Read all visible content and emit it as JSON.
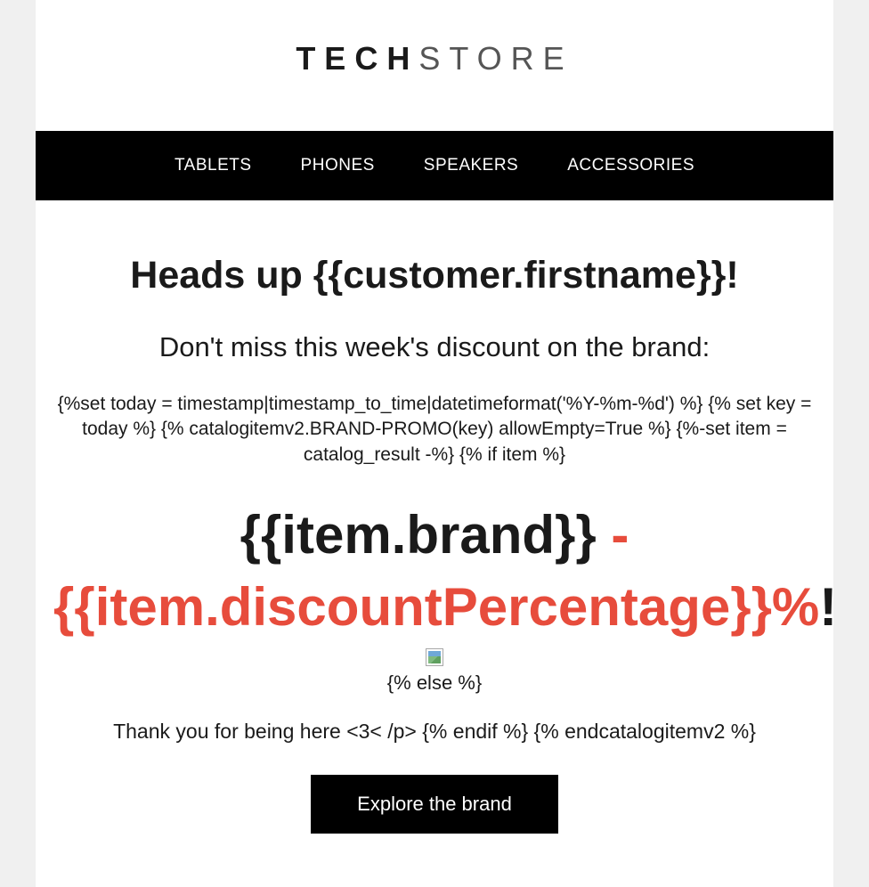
{
  "logo": {
    "bold": "TECH",
    "light": "STORE"
  },
  "nav": {
    "items": [
      "TABLETS",
      "PHONES",
      "SPEAKERS",
      "ACCESSORIES"
    ]
  },
  "content": {
    "heading1": "Heads up {{customer.firstname}}!",
    "heading2": "Don't miss this week's discount on the brand:",
    "template_code": "{%set today = timestamp|timestamp_to_time|datetimeformat('%Y-%m-%d') %} {% set key = today %} {% catalogitemv2.BRAND-PROMO(key) allowEmpty=True %} {%-set item = catalog_result -%} {% if item %}",
    "promo_brand": "{{item.brand}}",
    "promo_dash": " - ",
    "promo_discount": "{{item.discountPercentage}}%",
    "promo_exclaim": "!",
    "else_text": "{% else %}",
    "thank_text": "Thank you for being here <3< /p> {% endif %} {% endcatalogitemv2 %}",
    "cta_label": "Explore the brand"
  }
}
